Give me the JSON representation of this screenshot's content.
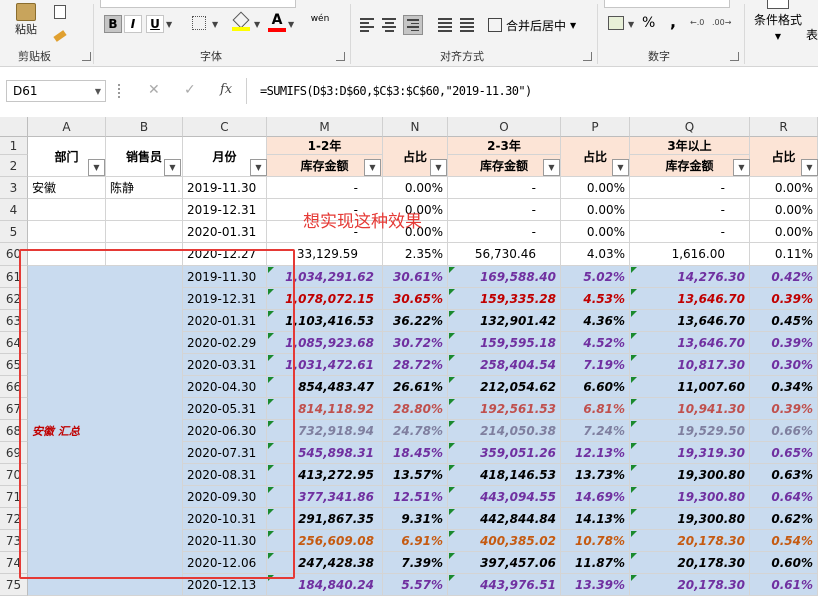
{
  "ribbon": {
    "paste": "粘贴",
    "clipboard": "剪贴板",
    "font": "字体",
    "alignment": "对齐方式",
    "merge": "合并后居中",
    "number": "数字",
    "percent": "%",
    "comma": ",",
    "wen": "wén",
    "cond_format": "条件格式",
    "biao": "表",
    "bold": "B",
    "italic": "I",
    "underline": "U",
    "font_color": "A"
  },
  "formula_bar": {
    "name_box": "D61",
    "fx": "fx",
    "cancel": "✕",
    "confirm": "✓",
    "formula": "=SUMIFS(D$3:D$60,$C$3:$C$60,\"2019-11.30\")"
  },
  "columns": [
    "A",
    "B",
    "C",
    "M",
    "N",
    "O",
    "P",
    "Q",
    "R"
  ],
  "header": {
    "dept": "部门",
    "sales": "销售员",
    "month": "月份",
    "g1": "1-2年",
    "g2": "2-3年",
    "g3": "3年以上",
    "amount": "库存金额",
    "ratio": "占比"
  },
  "annotation": "想实现这种效果",
  "summary_label": "安徽 汇总",
  "top_rows": [
    {
      "num": "3",
      "a": "安徽",
      "b": "陈静",
      "c": "2019-11.30",
      "m": "-",
      "n": "0.00%",
      "o": "-",
      "p": "0.00%",
      "q": "-",
      "r": "0.00%"
    },
    {
      "num": "4",
      "a": "",
      "b": "",
      "c": "2019-12.31",
      "m": "-",
      "n": "0.00%",
      "o": "-",
      "p": "0.00%",
      "q": "-",
      "r": "0.00%"
    },
    {
      "num": "5",
      "a": "",
      "b": "",
      "c": "2020-01.31",
      "m": "-",
      "n": "0.00%",
      "o": "-",
      "p": "0.00%",
      "q": "-",
      "r": "0.00%"
    },
    {
      "num": "60",
      "a": "",
      "b": "",
      "c": "2020-12.27",
      "m": "33,129.59",
      "n": "2.35%",
      "o": "56,730.46",
      "p": "4.03%",
      "q": "1,616.00",
      "r": "0.11%"
    }
  ],
  "summary_rows": [
    {
      "num": "61",
      "c": "2019-11.30",
      "m": "1,034,291.62",
      "n": "30.61%",
      "o": "169,588.40",
      "p": "5.02%",
      "q": "14,276.30",
      "r": "0.42%",
      "col": "#7030a0"
    },
    {
      "num": "62",
      "c": "2019-12.31",
      "m": "1,078,072.15",
      "n": "30.65%",
      "o": "159,335.28",
      "p": "4.53%",
      "q": "13,646.70",
      "r": "0.39%",
      "col": "#c00000"
    },
    {
      "num": "63",
      "c": "2020-01.31",
      "m": "1,103,416.53",
      "n": "36.22%",
      "o": "132,901.42",
      "p": "4.36%",
      "q": "13,646.70",
      "r": "0.45%",
      "col": "#000000"
    },
    {
      "num": "64",
      "c": "2020-02.29",
      "m": "1,085,923.68",
      "n": "30.72%",
      "o": "159,595.18",
      "p": "4.52%",
      "q": "13,646.70",
      "r": "0.39%",
      "col": "#7030a0"
    },
    {
      "num": "65",
      "c": "2020-03.31",
      "m": "1,031,472.61",
      "n": "28.72%",
      "o": "258,404.54",
      "p": "7.19%",
      "q": "10,817.30",
      "r": "0.30%",
      "col": "#7030a0"
    },
    {
      "num": "66",
      "c": "2020-04.30",
      "m": "854,483.47",
      "n": "26.61%",
      "o": "212,054.62",
      "p": "6.60%",
      "q": "11,007.60",
      "r": "0.34%",
      "col": "#000000"
    },
    {
      "num": "67",
      "c": "2020-05.31",
      "m": "814,118.92",
      "n": "28.80%",
      "o": "192,561.53",
      "p": "6.81%",
      "q": "10,941.30",
      "r": "0.39%",
      "col": "#c0504d"
    },
    {
      "num": "68",
      "c": "2020-06.30",
      "m": "732,918.94",
      "n": "24.78%",
      "o": "214,050.38",
      "p": "7.24%",
      "q": "19,529.50",
      "r": "0.66%",
      "col": "#7f7f9f"
    },
    {
      "num": "69",
      "c": "2020-07.31",
      "m": "545,898.31",
      "n": "18.45%",
      "o": "359,051.26",
      "p": "12.13%",
      "q": "19,319.30",
      "r": "0.65%",
      "col": "#7030a0"
    },
    {
      "num": "70",
      "c": "2020-08.31",
      "m": "413,272.95",
      "n": "13.57%",
      "o": "418,146.53",
      "p": "13.73%",
      "q": "19,300.80",
      "r": "0.63%",
      "col": "#000000"
    },
    {
      "num": "71",
      "c": "2020-09.30",
      "m": "377,341.86",
      "n": "12.51%",
      "o": "443,094.55",
      "p": "14.69%",
      "q": "19,300.80",
      "r": "0.64%",
      "col": "#7030a0"
    },
    {
      "num": "72",
      "c": "2020-10.31",
      "m": "291,867.35",
      "n": "9.31%",
      "o": "442,844.84",
      "p": "14.13%",
      "q": "19,300.80",
      "r": "0.62%",
      "col": "#000000"
    },
    {
      "num": "73",
      "c": "2020-11.30",
      "m": "256,609.08",
      "n": "6.91%",
      "o": "400,385.02",
      "p": "10.78%",
      "q": "20,178.30",
      "r": "0.54%",
      "col": "#c55a11"
    },
    {
      "num": "74",
      "c": "2020-12.06",
      "m": "247,428.38",
      "n": "7.39%",
      "o": "397,457.06",
      "p": "11.87%",
      "q": "20,178.30",
      "r": "0.60%",
      "col": "#000000"
    },
    {
      "num": "75",
      "c": "2020-12.13",
      "m": "184,840.24",
      "n": "5.57%",
      "o": "443,976.51",
      "p": "13.39%",
      "q": "20,178.30",
      "r": "0.61%",
      "col": "#7030a0"
    }
  ],
  "colors": {
    "highlight_box": "#e53935",
    "summary_bg": "#c9dbef",
    "group_header": "#fce4d6"
  }
}
